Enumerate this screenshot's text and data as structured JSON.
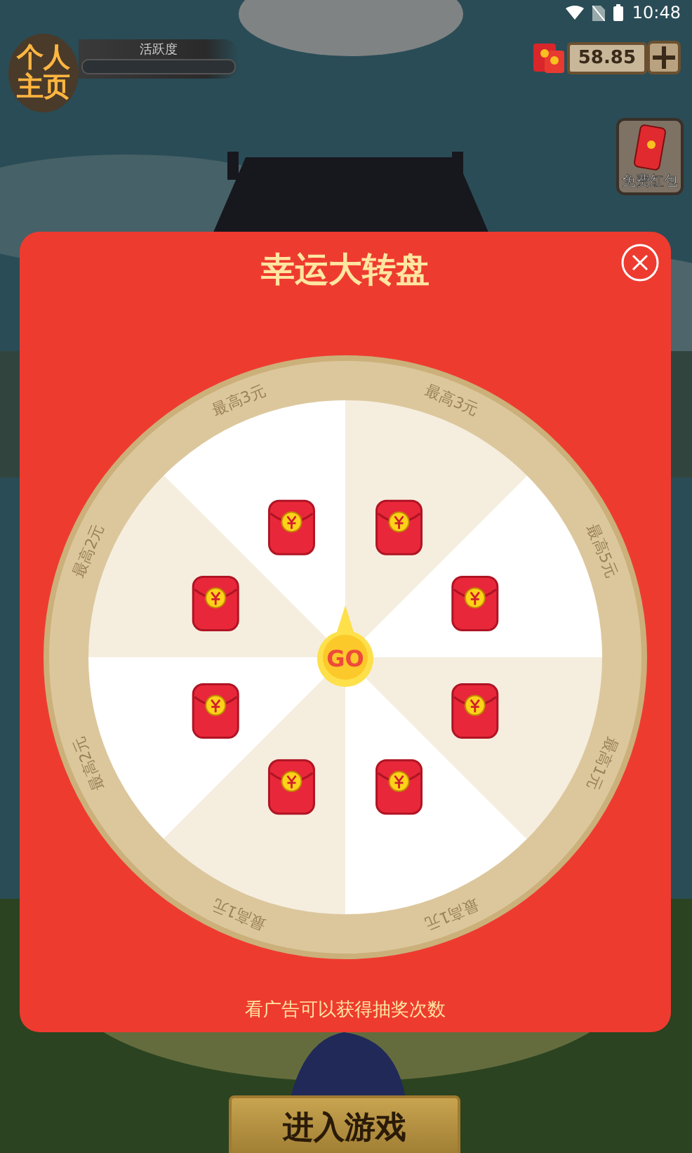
{
  "status_bar": {
    "time": "10:48"
  },
  "hud": {
    "logo": [
      "个人",
      "主页"
    ],
    "activity": {
      "label": "活跃度"
    },
    "balance": "58.85",
    "side_button": "免费红包"
  },
  "dialog": {
    "title": "幸运大转盘",
    "go": "GO",
    "hint": "看广告可以获得抽奖次数",
    "prizes": [
      {
        "label": "最高3元"
      },
      {
        "label": "最高5元"
      },
      {
        "label": "最高1元"
      },
      {
        "label": "最高1元"
      },
      {
        "label": "最高1元"
      },
      {
        "label": "最高2元"
      },
      {
        "label": "最高2元"
      },
      {
        "label": "最高3元"
      }
    ]
  },
  "enter_button": "进入游戏"
}
